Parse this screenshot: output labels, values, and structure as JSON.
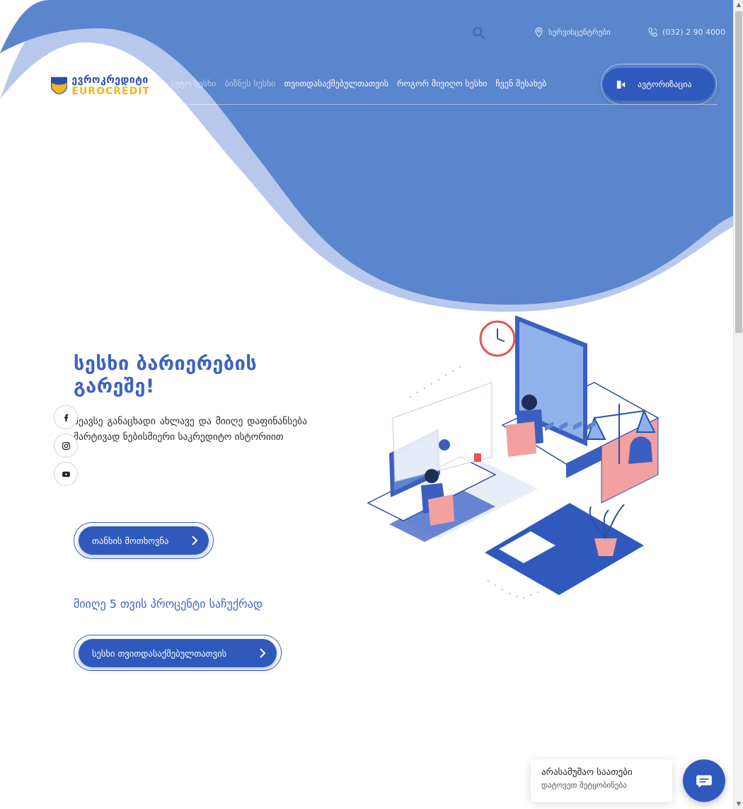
{
  "topbar": {
    "service_centers": "სერვისცენტრები",
    "phone": "(032) 2 90 4000"
  },
  "logo": {
    "name_ka": "ევროკრედიტი",
    "name_en": "EUROCREDIT"
  },
  "nav": {
    "items": [
      {
        "label": "ავტო სესხი"
      },
      {
        "label": "ბიზნეს სესხი"
      },
      {
        "label": "თვითდასაქმებულთათვის"
      },
      {
        "label": "როგორ მივიღო სესხი"
      },
      {
        "label": "ჩვენ შესახებ"
      }
    ],
    "auth_label": "ავტორიზაცია"
  },
  "social": [
    "facebook-icon",
    "instagram-icon",
    "youtube-icon"
  ],
  "hero": {
    "title": "სესხი ბარიერების გარეშე!",
    "description": "შეავსე განაცხადი ახლავე და მიიღე დაფინანსება მარტივად ნებისმიერი საკრედიტო ისტორიით",
    "cta_label": "თანხის მოთხოვნა",
    "promo": "მიიღე 5 თვის პროცენტი საჩუქრად",
    "cta2_label": "სესხი თვითდასაქმებულთათვის"
  },
  "chat": {
    "title": "არასამუშაო საათები",
    "subtitle": "დატოვეთ შეტყობინება"
  },
  "colors": {
    "primary": "#2f59bd",
    "wave_light": "#b8c8ec",
    "wave_main": "#5b85cc",
    "accent_yellow": "#f3b51d"
  }
}
